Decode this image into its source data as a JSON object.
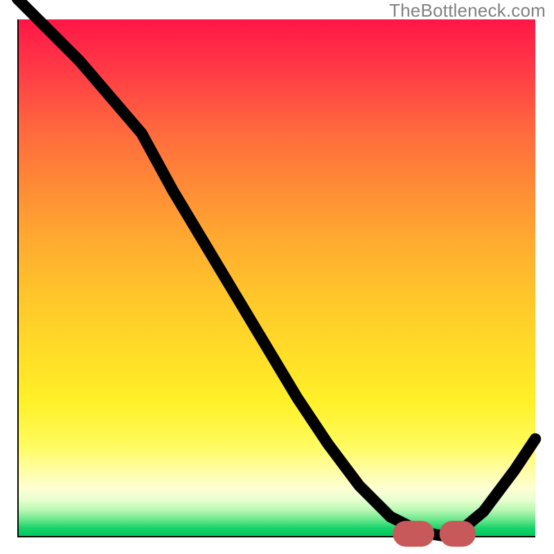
{
  "watermark": "TheBottleneck.com",
  "colors": {
    "gradient_top": "#ff1646",
    "gradient_bottom": "#00c85e",
    "curve": "#000000",
    "optimal_marker": "#c7595a",
    "axis": "#000000"
  },
  "chart_data": {
    "type": "line",
    "title": "",
    "xlabel": "",
    "ylabel": "",
    "xlim": [
      0,
      100
    ],
    "ylim": [
      0,
      100
    ],
    "series": [
      {
        "name": "bottleneck-curve",
        "x": [
          0,
          6,
          12,
          18,
          24,
          30,
          36,
          42,
          48,
          54,
          60,
          66,
          72,
          78,
          84,
          90,
          96,
          100
        ],
        "values": [
          104,
          98,
          92,
          85,
          78,
          67,
          57,
          47,
          37,
          27,
          18,
          10,
          4,
          1,
          0,
          5,
          13,
          19
        ]
      }
    ],
    "optimal_range": {
      "x_start": 75,
      "x_end": 86,
      "y": 0.7
    },
    "grid": false,
    "legend": false
  }
}
